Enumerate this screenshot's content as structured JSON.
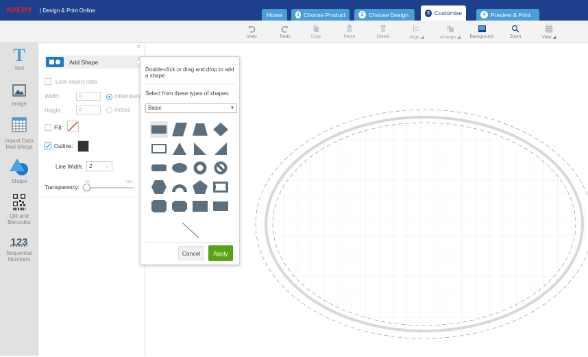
{
  "header": {
    "logo": "AVERY",
    "subtitle": "| Design & Print Online",
    "tabs": [
      {
        "num": "",
        "label": "Home"
      },
      {
        "num": "1",
        "label": "Choose Product"
      },
      {
        "num": "2",
        "label": "Choose Design"
      },
      {
        "num": "3",
        "label": "Customise"
      },
      {
        "num": "4",
        "label": "Preview & Print"
      }
    ],
    "active_tab": "Customise"
  },
  "toolbar": {
    "items": [
      {
        "label": "Undo",
        "icon": "undo-icon",
        "enabled": true
      },
      {
        "label": "Redo",
        "icon": "redo-icon",
        "enabled": true
      },
      {
        "label": "Copy",
        "icon": "copy-icon",
        "enabled": false
      },
      {
        "label": "Paste",
        "icon": "paste-icon",
        "enabled": false
      },
      {
        "label": "Delete",
        "icon": "trash-icon",
        "enabled": false
      },
      {
        "label": "Align",
        "icon": "align-icon",
        "enabled": false
      },
      {
        "label": "Arrange",
        "icon": "arrange-icon",
        "enabled": false
      },
      {
        "label": "Background",
        "icon": "background-icon",
        "enabled": true
      },
      {
        "label": "Zoom",
        "icon": "zoom-icon",
        "enabled": true
      },
      {
        "label": "View",
        "icon": "grid-icon",
        "enabled": true
      }
    ]
  },
  "sidebar": {
    "items": [
      {
        "label": "Text",
        "icon": "text-icon"
      },
      {
        "label": "Image",
        "icon": "image-icon"
      },
      {
        "label": "Import Data Mail Merge",
        "icon": "table-icon"
      },
      {
        "label": "Shape",
        "icon": "shape-icon"
      },
      {
        "label": "QR and Barcodes",
        "icon": "qr-code-icon"
      },
      {
        "label": "Sequential Numbers",
        "icon": "numbers-icon"
      }
    ],
    "active": "Shape"
  },
  "shape_panel": {
    "add_shape_label": "Add Shape",
    "close": "×",
    "lock_aspect_ratio": "Lock aspect ratio",
    "width_label": "Width:",
    "width_value": "0",
    "height_label": "Height:",
    "height_value": "0",
    "unit_millimeters": "millimeters",
    "unit_inches": "inches",
    "fill_label": "Fill:",
    "fill_checked": false,
    "outline_label": "Outline:",
    "outline_checked": true,
    "outline_color": "#333333",
    "line_width_label": "Line Width:",
    "line_width_value": "2",
    "transparency_label": "Transparency:",
    "transparency_min": "0%",
    "transparency_max": "65%",
    "transparency_value": 0
  },
  "shape_popup": {
    "instructions": "Double-click or drag and drop to add a shape",
    "select_label": "Select from these types of shapes:",
    "category": "Basic",
    "shapes": [
      "rectangle",
      "parallelogram",
      "trapezoid",
      "diamond",
      "rectangle-outline",
      "triangle",
      "right-triangle",
      "right-triangle-flipped",
      "rounded-rectangle",
      "ellipse",
      "ring",
      "no-symbol",
      "hexagon",
      "arch",
      "pentagon",
      "frame",
      "octagon-rectangle",
      "notched-rectangle",
      "plaque",
      "folded-rectangle",
      "line"
    ],
    "selected_shape": "rectangle",
    "cancel_label": "Cancel",
    "apply_label": "Apply"
  },
  "colors": {
    "brand_blue": "#1d3f8c",
    "tab_blue": "#4a9fd8",
    "apply_green": "#5aa317",
    "shape_fill": "#5c6f7e"
  }
}
